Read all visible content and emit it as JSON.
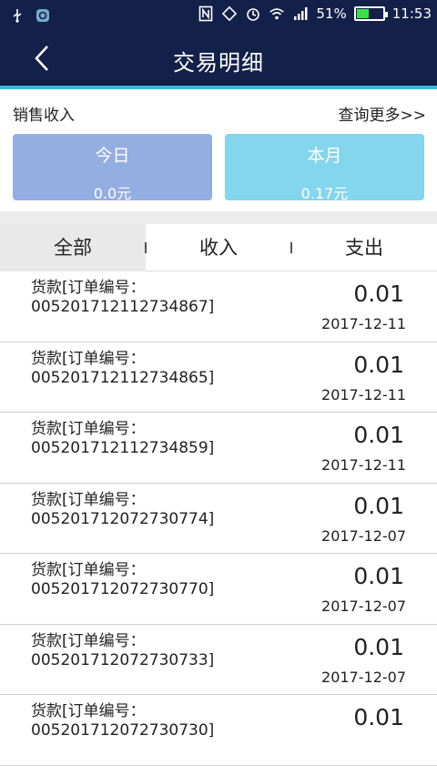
{
  "status_bar": {
    "battery": "51%",
    "battery_level": 0.51,
    "time": "11:53",
    "icons": [
      "usb-icon",
      "app-notification-icon",
      "nfc-icon",
      "rotate-icon",
      "alarm-icon",
      "wifi-icon",
      "signal-icon",
      "battery-icon"
    ]
  },
  "header": {
    "title": "交易明细",
    "back_icon": "chevron-left-icon"
  },
  "sales": {
    "label": "销售收入",
    "more": "查询更多>>",
    "today_label": "今日",
    "today_value": "0.0元",
    "month_label": "本月",
    "month_value": "0.17元"
  },
  "tabs": [
    {
      "label": "全部",
      "active": true
    },
    {
      "label": "收入",
      "active": false
    },
    {
      "label": "支出",
      "active": false
    }
  ],
  "transactions": [
    {
      "desc_line1": "货款[订单编号：",
      "desc_line2": "005201712112734867]",
      "amount": "0.01",
      "date": "2017-12-11"
    },
    {
      "desc_line1": "货款[订单编号：",
      "desc_line2": "005201712112734865]",
      "amount": "0.01",
      "date": "2017-12-11"
    },
    {
      "desc_line1": "货款[订单编号：",
      "desc_line2": "005201712112734859]",
      "amount": "0.01",
      "date": "2017-12-11"
    },
    {
      "desc_line1": "货款[订单编号：",
      "desc_line2": "005201712072730774]",
      "amount": "0.01",
      "date": "2017-12-07"
    },
    {
      "desc_line1": "货款[订单编号：",
      "desc_line2": "005201712072730770]",
      "amount": "0.01",
      "date": "2017-12-07"
    },
    {
      "desc_line1": "货款[订单编号：",
      "desc_line2": "005201712072730733]",
      "amount": "0.01",
      "date": "2017-12-07"
    },
    {
      "desc_line1": "货款[订单编号：",
      "desc_line2": "005201712072730730]",
      "amount": "0.01",
      "date": ""
    }
  ],
  "colors": {
    "header_bg": "#13214a",
    "accent": "#39b9d8",
    "today_card": "#94aee2",
    "month_card": "#84d5ee",
    "battery_fill": "#39e04a"
  }
}
